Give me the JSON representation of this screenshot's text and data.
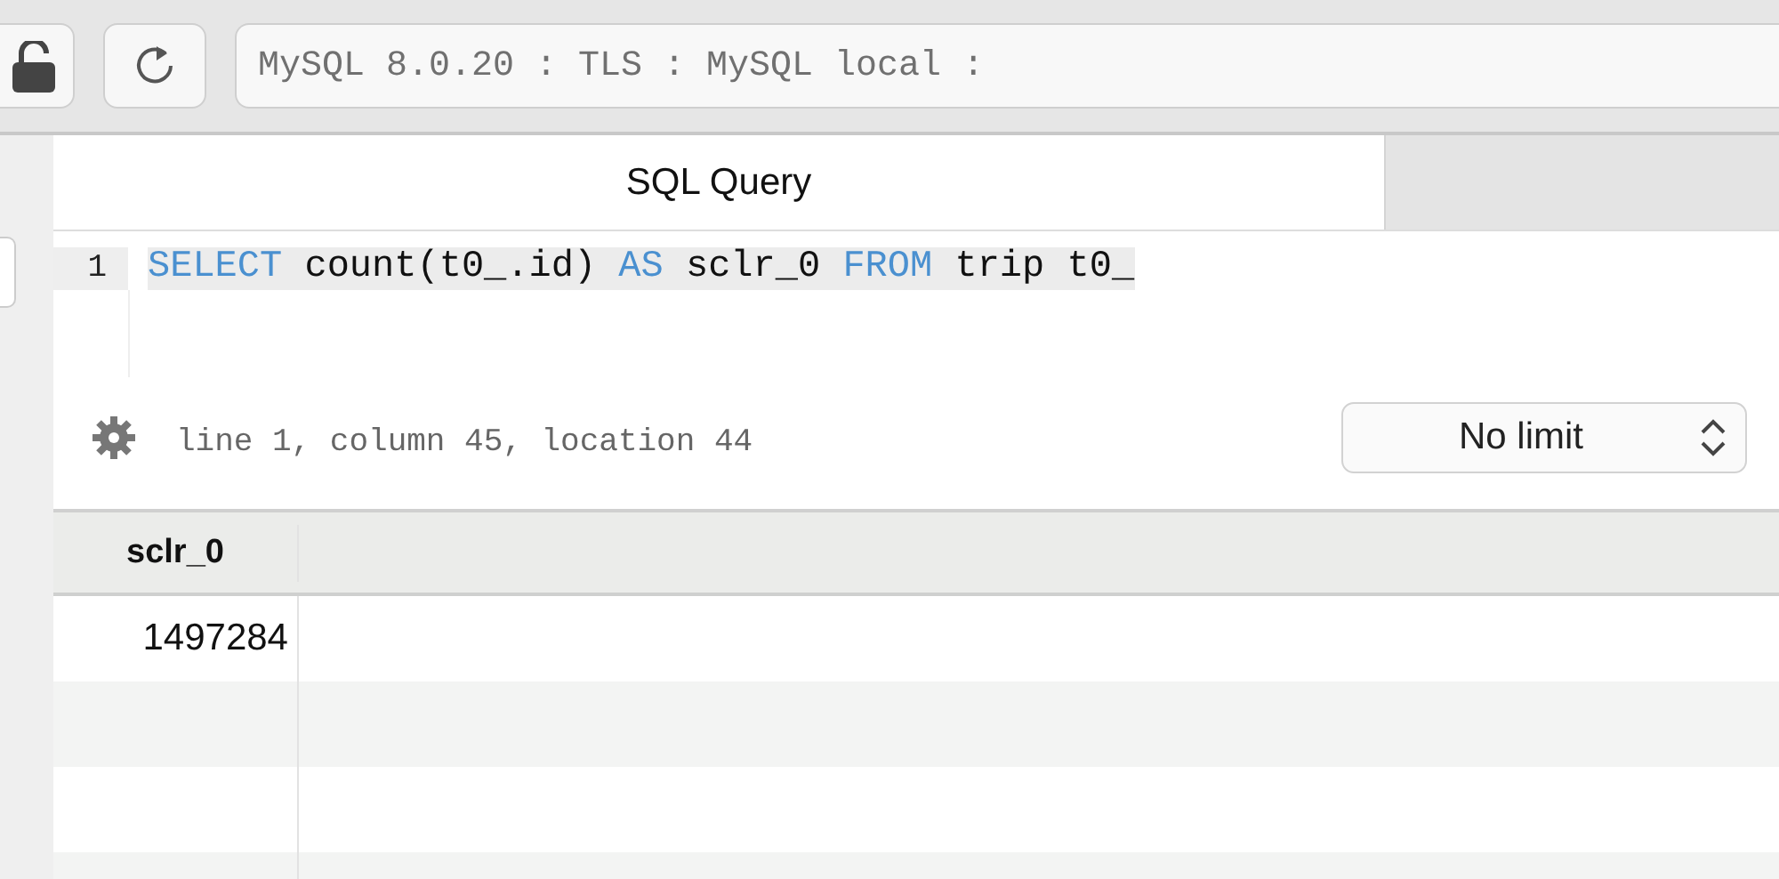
{
  "toolbar": {
    "address": "MySQL 8.0.20 : TLS : MySQL local :"
  },
  "tabs": [
    {
      "label": "SQL Query",
      "selected": true
    },
    {
      "selected": false
    }
  ],
  "editor": {
    "lines": [
      {
        "number": "1",
        "highlighted": true,
        "tokens": [
          {
            "kind": "keyword",
            "text": "SELECT"
          },
          {
            "kind": "plain",
            "text": " count(t0_.id) "
          },
          {
            "kind": "keyword",
            "text": "AS"
          },
          {
            "kind": "plain",
            "text": " sclr_0 "
          },
          {
            "kind": "keyword",
            "text": "FROM"
          },
          {
            "kind": "plain",
            "text": " trip t0_"
          }
        ]
      }
    ]
  },
  "status": {
    "position": "line 1, column 45, location 44",
    "limit": "No limit"
  },
  "results": {
    "columns": [
      "sclr_0"
    ],
    "rows": [
      [
        "1497284"
      ]
    ]
  }
}
